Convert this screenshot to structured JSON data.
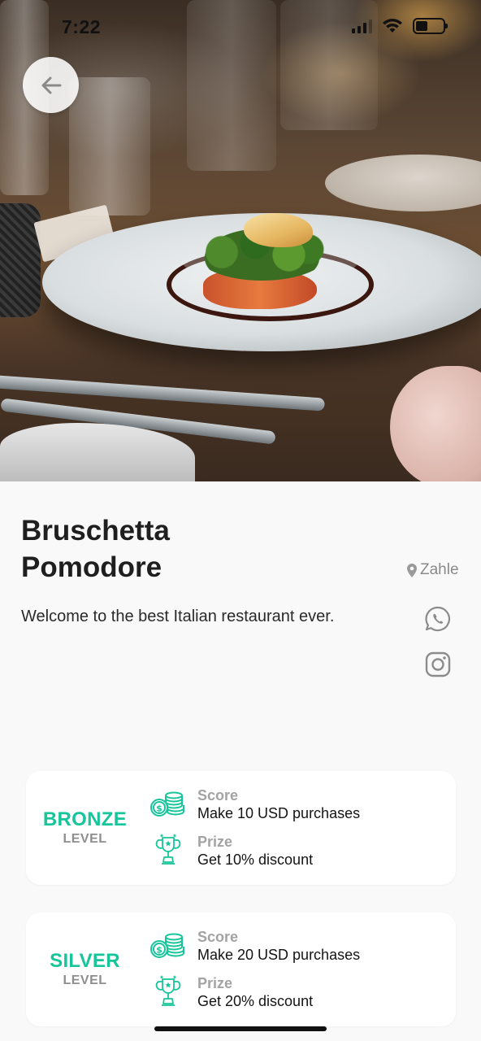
{
  "status_bar": {
    "time": "7:22"
  },
  "restaurant": {
    "name_line1": "Bruschetta",
    "name_line2": "Pomodore",
    "location": "Zahle",
    "description": "Welcome to the best Italian restaurant ever."
  },
  "icons": {
    "back": "arrow-left-icon",
    "location": "map-pin-icon",
    "whatsapp": "whatsapp-icon",
    "instagram": "instagram-icon",
    "score": "coins-icon",
    "prize": "trophy-icon"
  },
  "colors": {
    "accent": "#17c59b",
    "muted": "#8e8e8e",
    "background": "#f9f9f9"
  },
  "levels": [
    {
      "name": "BRONZE",
      "sub": "LEVEL",
      "score_label": "Score",
      "score_value": "Make 10 USD purchases",
      "prize_label": "Prize",
      "prize_value": "Get 10% discount"
    },
    {
      "name": "SILVER",
      "sub": "LEVEL",
      "score_label": "Score",
      "score_value": "Make 20 USD purchases",
      "prize_label": "Prize",
      "prize_value": "Get 20% discount"
    }
  ]
}
